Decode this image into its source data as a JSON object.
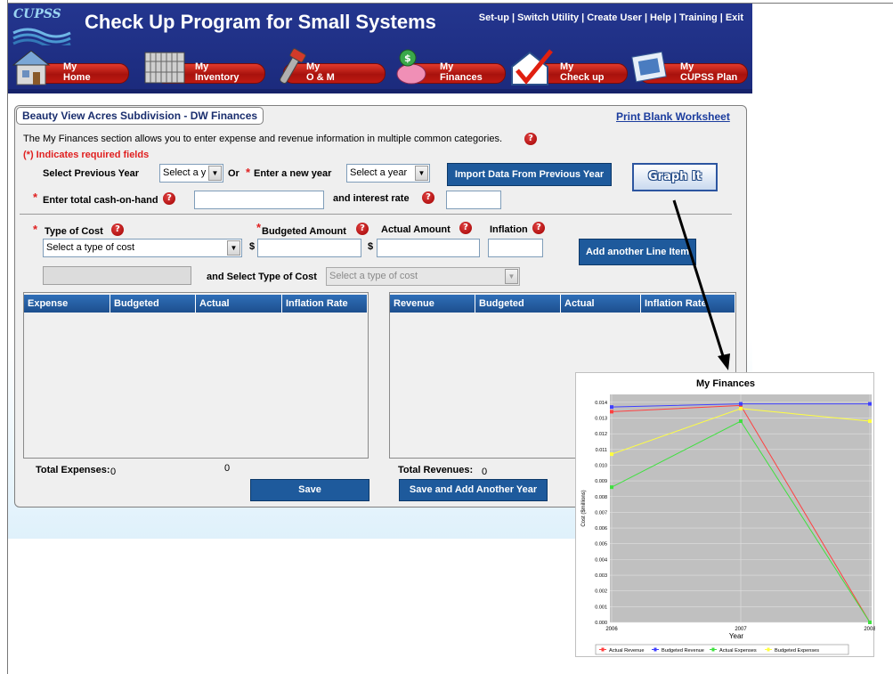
{
  "app": {
    "logo_text": "CUPSS",
    "title": "Check Up Program for Small Systems",
    "top_links": [
      "Set-up",
      "Switch Utility",
      "Create User",
      "Help",
      "Training",
      "Exit"
    ]
  },
  "nav": [
    {
      "line1": "My",
      "line2": "Home",
      "icon": "house-icon"
    },
    {
      "line1": "My",
      "line2": "Inventory",
      "icon": "pipes-icon"
    },
    {
      "line1": "My",
      "line2": "O & M",
      "icon": "wrench-icon"
    },
    {
      "line1": "My",
      "line2": "Finances",
      "icon": "piggy-bank-icon"
    },
    {
      "line1": "My",
      "line2": "Check up",
      "icon": "checkmark-house-icon"
    },
    {
      "line1": "My",
      "line2": "CUPSS Plan",
      "icon": "plan-document-icon"
    }
  ],
  "page": {
    "panel_title": "Beauty View Acres Subdivision - DW Finances",
    "print_link": "Print Blank Worksheet",
    "intro": "The My Finances section allows you to enter expense and revenue information in multiple common categories.",
    "required_note": "(*) Indicates required fields",
    "select_prev_year_label": "Select Previous Year",
    "select_prev_year_value": "Select a y",
    "or_label": "Or",
    "new_year_label": "Enter a new year",
    "new_year_value": "Select a year",
    "import_button": "Import Data From Previous Year",
    "graph_button": "Graph It",
    "cash_label": "Enter total cash-on-hand",
    "interest_label": "and interest rate",
    "type_of_cost_label": "Type of Cost",
    "type_of_cost_value": "Select a type of cost",
    "budgeted_label": "Budgeted Amount",
    "actual_label": "Actual Amount",
    "inflation_label": "Inflation",
    "currency_symbol": "$",
    "add_line_button": "Add another Line Item",
    "and_select_label": "and Select Type of Cost",
    "second_type_value": "Select a type of cost",
    "expense_headers": [
      "Expense",
      "Budgeted",
      "Actual",
      "Inflation Rate"
    ],
    "revenue_headers": [
      "Revenue",
      "Budgeted",
      "Actual",
      "Inflation Rate"
    ],
    "total_expenses_label": "Total Expenses:",
    "total_expenses_budgeted": "0",
    "total_expenses_actual": "0",
    "total_revenues_label": "Total Revenues:",
    "total_revenues_budgeted": "0",
    "save_button": "Save",
    "save_add_button": "Save and Add Another Year",
    "required_marker": "*"
  },
  "colors": {
    "header_bg": "#24368f",
    "nav_red": "#c01a12",
    "button_blue": "#1e5a9c",
    "table_header": "#2f6fb8"
  },
  "chart_data": {
    "type": "line",
    "title": "My Finances",
    "xlabel": "Year",
    "ylabel": "Cost ($millions)",
    "x": [
      "2006",
      "2007",
      "2008"
    ],
    "ylim": [
      0.0,
      0.0145
    ],
    "yticks": [
      "0.000",
      "0.001",
      "0.002",
      "0.003",
      "0.004",
      "0.005",
      "0.006",
      "0.007",
      "0.008",
      "0.009",
      "0.010",
      "0.011",
      "0.012",
      "0.013",
      "0.014"
    ],
    "series": [
      {
        "name": "Actual Revenue",
        "color": "#ff4040",
        "values": [
          0.0134,
          0.0138,
          0.0
        ]
      },
      {
        "name": "Budgeted Revenue",
        "color": "#4040ff",
        "values": [
          0.0137,
          0.0139,
          0.0139
        ]
      },
      {
        "name": "Actual Expenses",
        "color": "#40e040",
        "values": [
          0.0086,
          0.0128,
          0.0
        ]
      },
      {
        "name": "Budgeted Expenses",
        "color": "#ffff40",
        "values": [
          0.0107,
          0.0136,
          0.0128
        ]
      }
    ],
    "grid": true,
    "legend": "bottom"
  }
}
